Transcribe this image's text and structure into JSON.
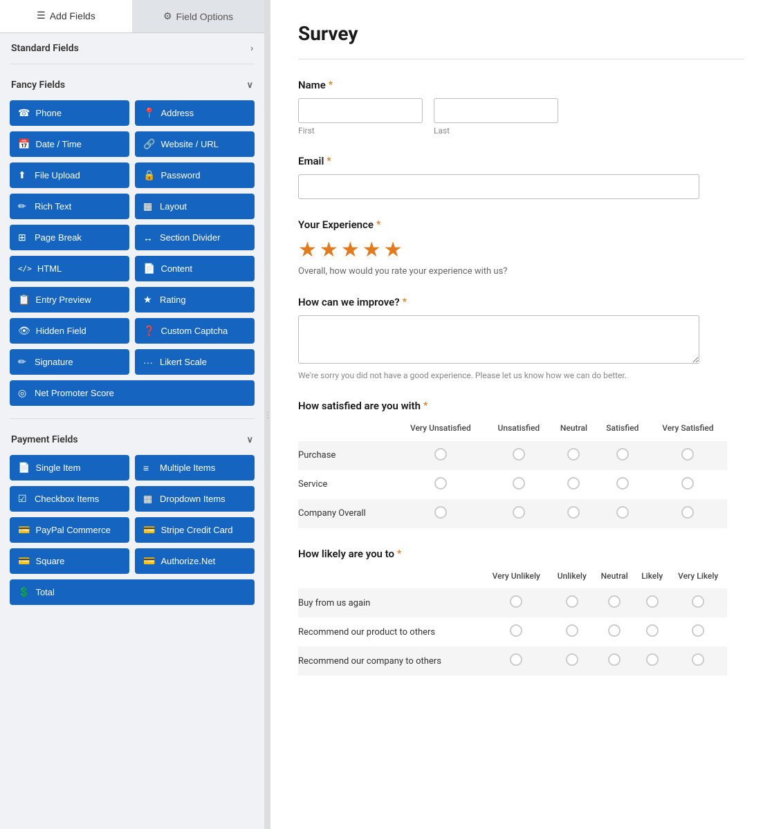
{
  "tabs": {
    "add_fields": "Add Fields",
    "field_options": "Field Options",
    "add_fields_icon": "☰",
    "field_options_icon": "⚙"
  },
  "left_panel": {
    "standard_fields": {
      "label": "Standard Fields",
      "collapsed": false
    },
    "fancy_fields": {
      "label": "Fancy Fields",
      "collapsed": false,
      "buttons": [
        {
          "id": "phone",
          "label": "Phone",
          "icon": "☎"
        },
        {
          "id": "address",
          "label": "Address",
          "icon": "📍"
        },
        {
          "id": "date-time",
          "label": "Date / Time",
          "icon": "📅"
        },
        {
          "id": "website-url",
          "label": "Website / URL",
          "icon": "🔗"
        },
        {
          "id": "file-upload",
          "label": "File Upload",
          "icon": "⬆"
        },
        {
          "id": "password",
          "label": "Password",
          "icon": "🔒"
        },
        {
          "id": "rich-text",
          "label": "Rich Text",
          "icon": "✏"
        },
        {
          "id": "layout",
          "label": "Layout",
          "icon": "▦"
        },
        {
          "id": "page-break",
          "label": "Page Break",
          "icon": "⊞"
        },
        {
          "id": "section-divider",
          "label": "Section Divider",
          "icon": "↔"
        },
        {
          "id": "html",
          "label": "HTML",
          "icon": "</>"
        },
        {
          "id": "content",
          "label": "Content",
          "icon": "📄"
        },
        {
          "id": "entry-preview",
          "label": "Entry Preview",
          "icon": "📋"
        },
        {
          "id": "rating",
          "label": "Rating",
          "icon": "★"
        },
        {
          "id": "hidden-field",
          "label": "Hidden Field",
          "icon": "👁"
        },
        {
          "id": "custom-captcha",
          "label": "Custom Captcha",
          "icon": "❓"
        },
        {
          "id": "signature",
          "label": "Signature",
          "icon": "✏"
        },
        {
          "id": "likert-scale",
          "label": "Likert Scale",
          "icon": "···"
        },
        {
          "id": "net-promoter-score",
          "label": "Net Promoter Score",
          "icon": "◎",
          "full": true
        }
      ]
    },
    "payment_fields": {
      "label": "Payment Fields",
      "collapsed": false,
      "buttons": [
        {
          "id": "single-item",
          "label": "Single Item",
          "icon": "📄"
        },
        {
          "id": "multiple-items",
          "label": "Multiple Items",
          "icon": "≡"
        },
        {
          "id": "checkbox-items",
          "label": "Checkbox Items",
          "icon": "☑"
        },
        {
          "id": "dropdown-items",
          "label": "Dropdown Items",
          "icon": "▦"
        },
        {
          "id": "paypal-commerce",
          "label": "PayPal Commerce",
          "icon": "💳"
        },
        {
          "id": "stripe-credit-card",
          "label": "Stripe Credit Card",
          "icon": "💳"
        },
        {
          "id": "square",
          "label": "Square",
          "icon": "💳"
        },
        {
          "id": "authorize-net",
          "label": "Authorize.Net",
          "icon": "💳"
        },
        {
          "id": "total",
          "label": "Total",
          "icon": "💲",
          "full": true
        }
      ]
    }
  },
  "form": {
    "title": "Survey",
    "fields": [
      {
        "id": "name",
        "label": "Name",
        "required": true,
        "type": "name",
        "first_placeholder": "",
        "last_placeholder": "",
        "first_label": "First",
        "last_label": "Last"
      },
      {
        "id": "email",
        "label": "Email",
        "required": true,
        "type": "email"
      },
      {
        "id": "experience",
        "label": "Your Experience",
        "required": true,
        "type": "star-rating",
        "stars": 5,
        "description": "Overall, how would you rate your experience with us?"
      },
      {
        "id": "improve",
        "label": "How can we improve?",
        "required": true,
        "type": "textarea",
        "hint": "We're sorry you did not have a good experience. Please let us know how we can do better."
      },
      {
        "id": "satisfaction",
        "label": "How satisfied are you with",
        "required": true,
        "type": "likert",
        "columns": [
          "Very Unsatisfied",
          "Unsatisfied",
          "Neutral",
          "Satisfied",
          "Very Satisfied"
        ],
        "rows": [
          "Purchase",
          "Service",
          "Company Overall"
        ]
      },
      {
        "id": "likelihood",
        "label": "How likely are you to",
        "required": true,
        "type": "likert",
        "columns": [
          "Very Unlikely",
          "Unlikely",
          "Neutral",
          "Likely",
          "Very Likely"
        ],
        "rows": [
          "Buy from us again",
          "Recommend our product to others",
          "Recommend our company to others"
        ]
      }
    ]
  }
}
